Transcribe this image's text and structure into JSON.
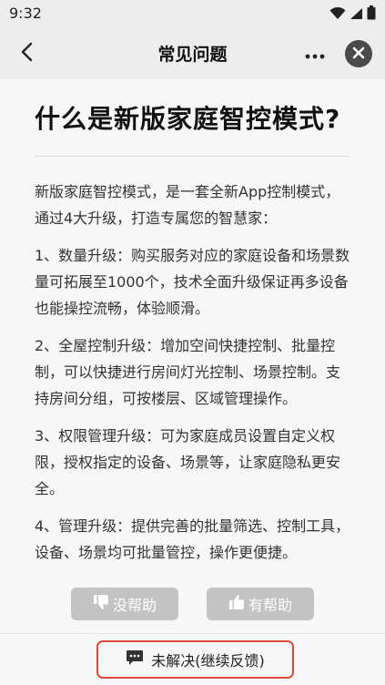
{
  "status_bar": {
    "time": "9:32",
    "icons": [
      "wifi-icon",
      "signal-icon",
      "battery-icon"
    ]
  },
  "nav": {
    "title": "常见问题",
    "back_icon": "chevron-left-icon",
    "more_icon": "more-icon",
    "close_icon": "close-icon"
  },
  "article": {
    "title": "什么是新版家庭智控模式?",
    "paragraphs": [
      "新版家庭智控模式，是一套全新App控制模式，通过4大升级，打造专属您的智慧家：",
      "1、数量升级：购买服务对应的家庭设备和场景数量可拓展至1000个，技术全面升级保证再多设备也能操控流畅，体验顺滑。",
      "2、全屋控制升级：增加空间快捷控制、批量控制，可以快捷进行房间灯光控制、场景控制。支持房间分组，可按楼层、区域管理操作。",
      "3、权限管理升级：可为家庭成员设置自定义权限，授权指定的设备、场景等，让家庭隐私更安全。",
      "4、管理升级：提供完善的批量筛选、控制工具，设备、场景均可批量管控，操作更便捷。"
    ]
  },
  "feedback": {
    "not_helpful_label": "没帮助",
    "helpful_label": "有帮助"
  },
  "bottom": {
    "unresolved_label": "未解决(继续反馈)"
  },
  "colors": {
    "background": "#ededed",
    "card": "#f7f7f7",
    "feedback_button": "#c3c3c3",
    "highlight_border": "#d94a3a"
  }
}
